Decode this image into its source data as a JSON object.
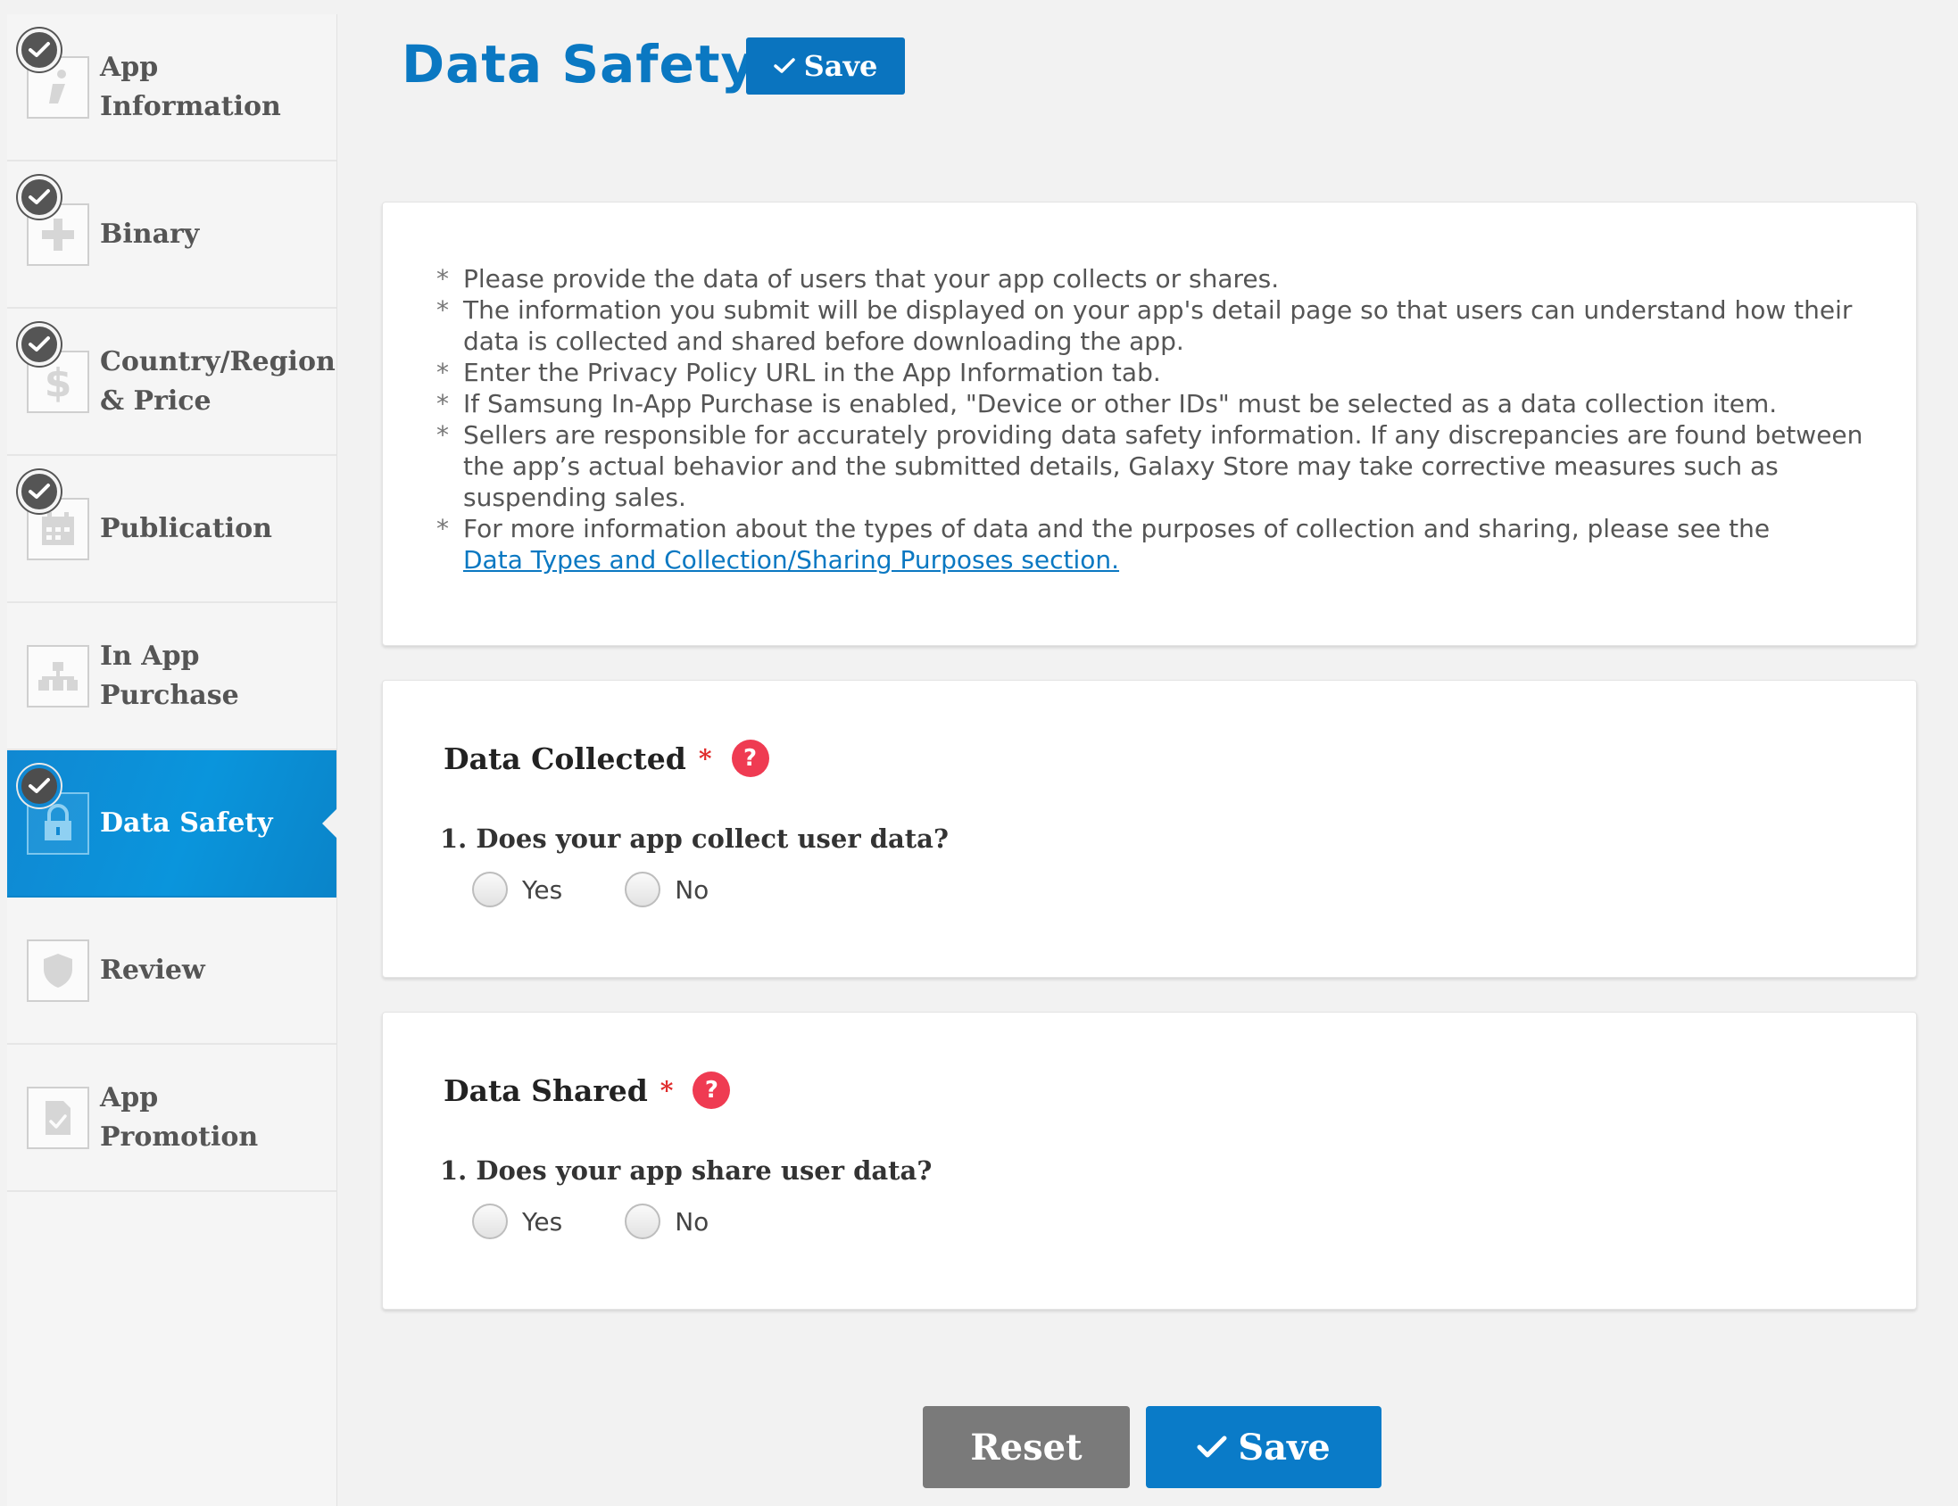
{
  "sidebar": {
    "items": [
      {
        "label": "App Information",
        "icon": "info-icon",
        "completed": true,
        "active": false
      },
      {
        "label": "Binary",
        "icon": "plus-icon",
        "completed": true,
        "active": false
      },
      {
        "label": "Country/Region & Price",
        "icon": "dollar-icon",
        "completed": true,
        "active": false
      },
      {
        "label": "Publication",
        "icon": "calendar-icon",
        "completed": true,
        "active": false
      },
      {
        "label": "In App Purchase",
        "icon": "hierarchy-icon",
        "completed": false,
        "active": false
      },
      {
        "label": "Data Safety",
        "icon": "lock-icon",
        "completed": true,
        "active": true
      },
      {
        "label": "Review",
        "icon": "shield-icon",
        "completed": false,
        "active": false
      },
      {
        "label": "App Promotion",
        "icon": "document-check-icon",
        "completed": false,
        "active": false
      }
    ]
  },
  "header": {
    "title": "Data Safety",
    "save_label": "Save"
  },
  "info": {
    "notes": [
      "Please provide the data of users that your app collects or shares.",
      "The information you submit will be displayed on your app's detail page so that users can understand how their data is collected and shared before downloading the app.",
      "Enter the Privacy Policy URL in the App Information tab.",
      "If Samsung In-App Purchase is enabled, \"Device or other IDs\" must be selected as a data collection item.",
      "Sellers are responsible for accurately providing data safety information. If any discrepancies are found between the app’s actual behavior and the submitted details, Galaxy Store may take corrective measures such as suspending sales.",
      "For more information about the types of data and the purposes of collection and sharing, please see the"
    ],
    "link_text": "Data Types and Collection/Sharing Purposes section."
  },
  "collected": {
    "title": "Data Collected",
    "required_mark": "*",
    "help_glyph": "?",
    "question": "1. Does your app collect user data?",
    "options": [
      "Yes",
      "No"
    ]
  },
  "shared": {
    "title": "Data Shared",
    "required_mark": "*",
    "help_glyph": "?",
    "question": "1. Does your app share user data?",
    "options": [
      "Yes",
      "No"
    ]
  },
  "footer": {
    "reset_label": "Reset",
    "save_label": "Save"
  },
  "colors": {
    "accent": "#0a78c2",
    "active_nav": "#1088d2",
    "help": "#ef3b52",
    "required": "#e02b2b",
    "reset": "#7a7a7a"
  }
}
